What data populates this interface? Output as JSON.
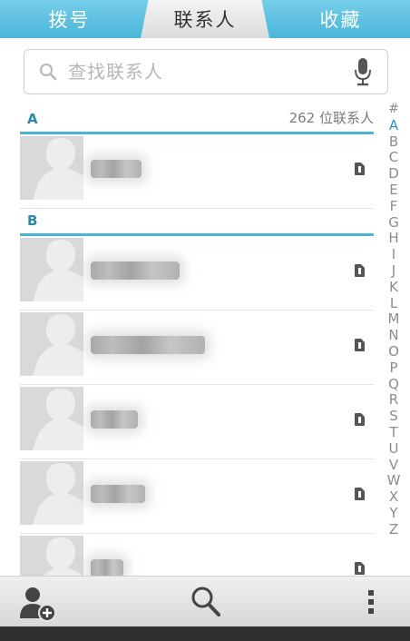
{
  "tabs": [
    {
      "label": "拨号",
      "active": false
    },
    {
      "label": "联系人",
      "active": true
    },
    {
      "label": "收藏",
      "active": false
    }
  ],
  "search": {
    "placeholder": "查找联系人"
  },
  "sections": [
    {
      "letter": "A",
      "count_label": "262 位联系人"
    },
    {
      "letter": "B",
      "count_label": ""
    }
  ],
  "index_letters": [
    "#",
    "A",
    "B",
    "C",
    "D",
    "E",
    "F",
    "G",
    "H",
    "I",
    "J",
    "K",
    "L",
    "M",
    "N",
    "O",
    "P",
    "Q",
    "R",
    "S",
    "T",
    "U",
    "V",
    "W",
    "X",
    "Y",
    "Z"
  ],
  "index_active": "A",
  "colors": {
    "accent": "#49b4d8",
    "tab_bar": "#5bbfe0",
    "section_letter": "#2f86b0"
  }
}
